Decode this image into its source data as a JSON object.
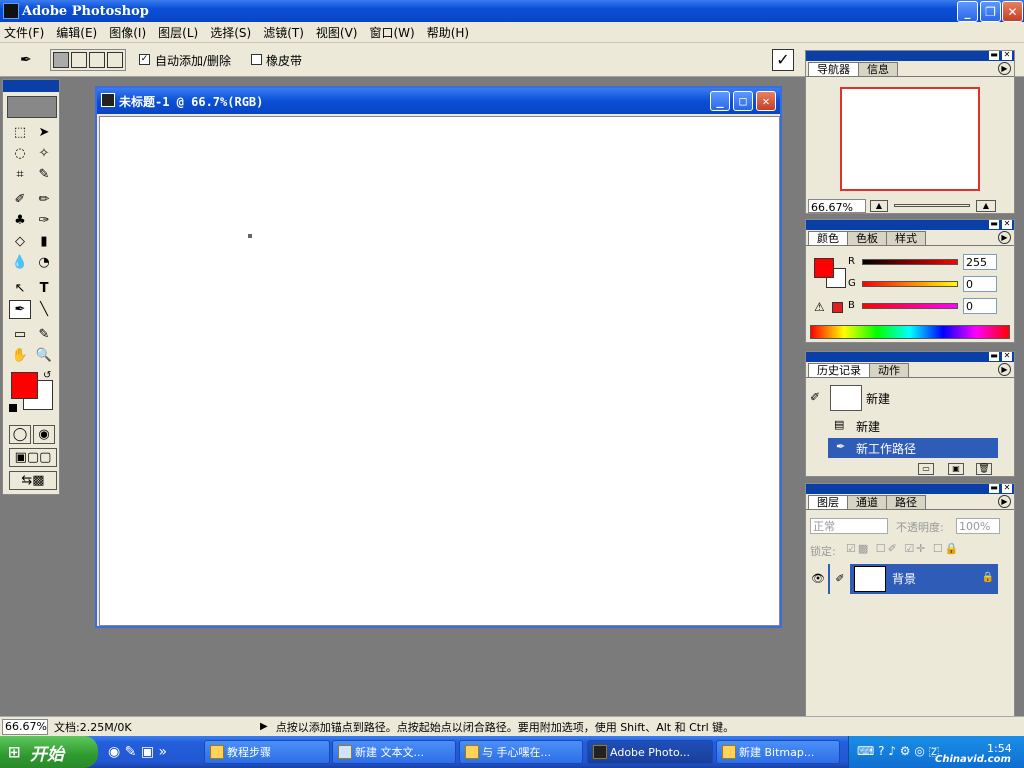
{
  "app": {
    "title": "Adobe Photoshop"
  },
  "menu": [
    "文件(F)",
    "编辑(E)",
    "图像(I)",
    "图层(L)",
    "选择(S)",
    "滤镜(T)",
    "视图(V)",
    "窗口(W)",
    "帮助(H)"
  ],
  "options": {
    "auto_add_delete": "自动添加/删除",
    "rubber_band": "橡皮带"
  },
  "document": {
    "title": "未标题-1 @ 66.7%(RGB)"
  },
  "navigator": {
    "tabs": [
      "导航器",
      "信息"
    ],
    "zoom": "66.67%"
  },
  "color": {
    "tabs": [
      "颜色",
      "色板",
      "样式"
    ],
    "r_label": "R",
    "g_label": "G",
    "b_label": "B",
    "r_value": "255",
    "g_value": "0",
    "b_value": "0",
    "foreground": "#ff0000"
  },
  "history": {
    "tabs": [
      "历史记录",
      "动作"
    ],
    "snapshot": "新建",
    "items": [
      "新建",
      "新工作路径"
    ]
  },
  "layers": {
    "tabs": [
      "图层",
      "通道",
      "路径"
    ],
    "blend_mode": "正常",
    "opacity_label": "不透明度:",
    "opacity_value": "100%",
    "lock_label": "锁定:",
    "layer_name": "背景"
  },
  "status": {
    "zoom": "66.67%",
    "doc_info": "文档:2.25M/0K",
    "hint": "点按以添加锚点到路径。点按起始点以闭合路径。要用附加选项，使用 Shift、Alt 和 Ctrl 键。"
  },
  "taskbar": {
    "start": "开始",
    "items": [
      "教程步骤",
      "新建 文本文...",
      "与 手心嘿在...",
      "Adobe Photo...",
      "新建 Bitmap..."
    ],
    "clock": "1:54"
  },
  "watermark": "Chinavid.com"
}
